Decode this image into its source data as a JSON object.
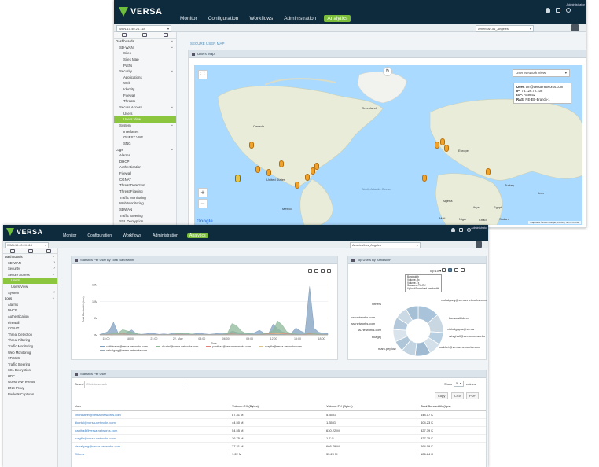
{
  "brand": {
    "name": "VERSA",
    "sub": "NETWORKS",
    "green": "#6fbf3c",
    "dark": "#0e2b3e",
    "accent": "#8cc63f"
  },
  "user_name": "Administrator",
  "nav": [
    "Monitor",
    "Configuration",
    "Workflows",
    "Administration",
    "Analytics"
  ],
  "nav_active": "Analytics",
  "w1": {
    "appliance": "WAN-10.40.24.118",
    "timezone": "America/Los_Angeles",
    "breadcrumb": "SECURE USER MAP",
    "panel_title": "Users Map",
    "map_view": "User Network View",
    "popup": {
      "user_label": "User:",
      "user": "tim@versa-networks.com",
      "ip_label": "IP:",
      "ip": "76.126.72.108",
      "isp_label": "ISP:",
      "isp": "AS9852",
      "ras_label": "RAS:",
      "ras": "NE-EE-Branch-1"
    },
    "map_labels": [
      "Greenland",
      "Canada",
      "United States",
      "Mexico",
      "North Atlantic Ocean",
      "Europe",
      "Algeria",
      "Libya",
      "Egypt",
      "Mali",
      "Niger",
      "Chad",
      "Sudan",
      "Turkey",
      "Iran"
    ],
    "attribution": "Map data ©2020 Google, INEGI | Terms of Use",
    "google": "Google",
    "sidebar": [
      {
        "label": "Dashboards",
        "level": 0,
        "chev": "⌄"
      },
      {
        "label": "SD-WAN",
        "level": 1,
        "chev": "⌄"
      },
      {
        "label": "Sites",
        "level": 2
      },
      {
        "label": "Sites Map",
        "level": 2
      },
      {
        "label": "Paths",
        "level": 2
      },
      {
        "label": "Security",
        "level": 1,
        "chev": "⌄"
      },
      {
        "label": "Applications",
        "level": 2
      },
      {
        "label": "Web",
        "level": 2
      },
      {
        "label": "Identity",
        "level": 2
      },
      {
        "label": "Firewall",
        "level": 2
      },
      {
        "label": "Threats",
        "level": 2
      },
      {
        "label": "Secure Access",
        "level": 1,
        "chev": "⌄"
      },
      {
        "label": "Users",
        "level": 2
      },
      {
        "label": "Users View",
        "level": 2,
        "active": true
      },
      {
        "label": "System",
        "level": 1,
        "chev": "⌄"
      },
      {
        "label": "Interfaces",
        "level": 2
      },
      {
        "label": "GUEST VNF",
        "level": 2
      },
      {
        "label": "SNG",
        "level": 2
      },
      {
        "label": "Logs",
        "level": 0,
        "chev": "⌄"
      },
      {
        "label": "Alarms",
        "level": 1
      },
      {
        "label": "DHCP",
        "level": 1
      },
      {
        "label": "Authentication",
        "level": 1
      },
      {
        "label": "Firewall",
        "level": 1
      },
      {
        "label": "CGNAT",
        "level": 1
      },
      {
        "label": "Threat Detection",
        "level": 1
      },
      {
        "label": "Threat Filtering",
        "level": 1
      },
      {
        "label": "Traffic Monitoring",
        "level": 1
      },
      {
        "label": "Web Monitoring",
        "level": 1
      },
      {
        "label": "SDWAN",
        "level": 1
      },
      {
        "label": "Traffic Steering",
        "level": 1
      },
      {
        "label": "SSL Decryption",
        "level": 1
      }
    ]
  },
  "w2": {
    "appliance": "WAN-10.40.24.118",
    "timezone": "America/Los_Angeles",
    "sidebar": [
      {
        "label": "Dashboards",
        "level": 0,
        "chev": "⌄"
      },
      {
        "label": "SD-WAN",
        "level": 1,
        "chev": "›"
      },
      {
        "label": "Security",
        "level": 1,
        "chev": "›"
      },
      {
        "label": "Secure Access",
        "level": 1,
        "chev": "⌄"
      },
      {
        "label": "Users",
        "level": 2,
        "active": true
      },
      {
        "label": "Users View",
        "level": 2
      },
      {
        "label": "System",
        "level": 1,
        "chev": "›"
      },
      {
        "label": "Logs",
        "level": 0,
        "chev": "⌄"
      },
      {
        "label": "Alarms",
        "level": 1
      },
      {
        "label": "DHCP",
        "level": 1
      },
      {
        "label": "Authentication",
        "level": 1
      },
      {
        "label": "Firewall",
        "level": 1
      },
      {
        "label": "CGNAT",
        "level": 1
      },
      {
        "label": "Threat Detection",
        "level": 1
      },
      {
        "label": "Threat Filtering",
        "level": 1
      },
      {
        "label": "Traffic Monitoring",
        "level": 1
      },
      {
        "label": "Web Monitoring",
        "level": 1
      },
      {
        "label": "SDWAN",
        "level": 1
      },
      {
        "label": "Traffic Steering",
        "level": 1
      },
      {
        "label": "SSL Decryption",
        "level": 1
      },
      {
        "label": "HDC",
        "level": 1
      },
      {
        "label": "Guest VNF events",
        "level": 1
      },
      {
        "label": "DNS Proxy",
        "level": 1
      },
      {
        "label": "Packets Captures",
        "level": 1
      }
    ],
    "stats_title": "Statistics Per User By Total Bandwidth",
    "top_title": "Top Users By Bandwidth",
    "top_control": "Top 10",
    "tooltip": [
      "Bandwidth",
      "Volume-Rx",
      "Volume-Tx",
      "Sessions-TX-RX",
      "Upload/Download bandwidth"
    ],
    "stats_table_title": "Statistics Per User",
    "search_label": "Search",
    "search_placeholder": "Click to serach",
    "show_label": "Show",
    "show_value": "5",
    "entries_label": "entries",
    "buttons": [
      "Copy",
      "CSV",
      "PDF"
    ],
    "columns": [
      "User",
      "Volume-RX (Bytes)",
      "Volume-TX (Bytes)",
      "Total Bandwidth (bps)"
    ],
    "rows": [
      [
        "cnithinavel@versa-networks.com",
        "87.31 M",
        "5.35 G",
        "644.17 K"
      ],
      [
        "dkurtal@versa-networks.com",
        "44.50 M",
        "1.35 G",
        "404.23 K"
      ],
      [
        "pantha4@versa-networks.com",
        "54.55 M",
        "630.22 M",
        "327.39 K"
      ],
      [
        "rvagfla@versa-networks.com",
        "26.75 M",
        "1.7 G",
        "327.75 K"
      ],
      [
        "vishalgarg@versa-networks.com",
        "27.21 M",
        "666.79 M",
        "264.09 K"
      ],
      [
        "Others",
        "1.22 M",
        "35.20 M",
        "126.84 K"
      ]
    ],
    "donut_labels": [
      "Others",
      "cs-networks.com",
      "ss-networks.com",
      "ss-networks.com",
      "bkagaj",
      "mark.peplow",
      "parkhet@versa-networks.com",
      "rvisghall@versa-networks",
      "vishalgupta@versa",
      "kumarsikidmo",
      "vishalgarg@versa-networks.com"
    ]
  },
  "chart_data": [
    {
      "type": "area",
      "title": "Statistics Per User By Total Bandwidth",
      "ylabel": "Total Bandwidth (bps)",
      "xlabel": "Time",
      "y_ticks": [
        "0M",
        "5M",
        "10M",
        "15M"
      ],
      "x_ticks": [
        "15:00",
        "18:00",
        "21:00",
        "22. May",
        "03:00",
        "06:00",
        "09:00",
        "12:00",
        "15:00",
        "18:00"
      ],
      "ylim": [
        0,
        16
      ],
      "series": [
        {
          "name": "cnithinavel@versa-networks.com",
          "color": "#7f9fbf",
          "values": [
            0.2,
            0.5,
            1.2,
            3.8,
            0.6,
            0.3,
            0.8,
            1.5,
            0.4,
            0.2,
            0.3,
            0.5,
            0.4,
            0.2,
            0.3,
            0.2,
            0.5,
            0.6,
            0.4,
            0.3,
            0.2,
            0.4,
            0.5,
            0.3,
            0.2,
            0.3,
            0.5,
            0.6,
            0.4,
            1.1,
            0.8,
            0.4,
            0.3,
            0.5,
            0.7,
            1.4,
            0.6,
            0.4,
            3.2,
            1.8,
            0.9,
            0.6,
            0.5,
            2.1,
            1.2,
            0.6,
            14.5,
            2.0,
            0.8,
            0.5,
            0.4
          ]
        },
        {
          "name": "dkurtal@versa-networks.com",
          "color": "#8fb89a",
          "values": [
            0.1,
            0.2,
            0.3,
            0.4,
            0.6,
            1.6,
            1.2,
            0.8,
            0.4,
            0.2,
            0.1,
            0.1,
            0.1,
            0.1,
            0.1,
            0.1,
            0.2,
            0.4,
            0.6,
            0.5,
            0.3,
            0.2,
            0.1,
            0.1,
            0.1,
            0.1,
            0.1,
            0.2,
            0.5,
            3.4,
            2.8,
            1.2,
            0.5,
            0.3,
            0.2,
            0.2,
            0.4,
            0.6,
            1.5,
            4.2,
            3.0,
            1.0,
            0.5,
            0.3,
            0.2,
            0.3,
            0.5,
            0.4,
            0.3,
            0.2,
            0.1
          ]
        },
        {
          "name": "pantha4@versa-networks.com",
          "color": "#e0807a",
          "values": [
            0.1,
            0.1,
            0.2,
            0.2,
            0.2,
            0.3,
            0.2,
            0.1,
            0.1,
            0.1,
            0.1,
            0.1,
            0.1,
            0.1,
            0.1,
            0.1,
            0.1,
            0.2,
            0.2,
            0.1,
            0.1,
            0.1,
            0.1,
            0.1,
            0.1,
            0.1,
            0.1,
            0.1,
            0.2,
            0.3,
            0.2,
            0.2,
            0.1,
            0.1,
            0.1,
            0.1,
            0.2,
            0.3,
            0.4,
            0.6,
            0.5,
            0.3,
            0.2,
            0.1,
            0.1,
            0.2,
            0.3,
            0.2,
            0.1,
            0.1,
            0.1
          ]
        },
        {
          "name": "rvagfla@versa-networks.com",
          "color": "#d9c38a",
          "values": [
            0.1,
            0.1,
            0.1,
            0.2,
            0.2,
            0.2,
            0.1,
            0.1,
            0.1,
            0.1,
            0.1,
            0.1,
            0.1,
            0.1,
            0.1,
            0.1,
            0.1,
            0.1,
            0.1,
            0.1,
            0.1,
            0.1,
            0.1,
            0.1,
            0.1,
            0.1,
            0.1,
            0.1,
            0.1,
            0.2,
            0.2,
            0.1,
            0.1,
            0.1,
            0.1,
            0.1,
            0.1,
            0.2,
            0.3,
            0.4,
            0.3,
            0.2,
            0.1,
            0.1,
            0.1,
            0.1,
            0.2,
            0.2,
            0.1,
            0.1,
            0.1
          ]
        },
        {
          "name": "vishalgarg@versa-networks.com",
          "color": "#9aa7b5",
          "values": [
            0.1,
            0.1,
            0.1,
            0.1,
            0.1,
            0.1,
            0.1,
            0.1,
            0.1,
            0.1,
            0.1,
            0.1,
            0.1,
            0.1,
            0.1,
            0.1,
            0.1,
            0.1,
            0.1,
            0.1,
            0.1,
            0.1,
            0.1,
            0.1,
            0.1,
            0.1,
            0.1,
            0.1,
            0.1,
            0.1,
            0.1,
            0.1,
            0.1,
            0.1,
            0.1,
            0.1,
            0.1,
            0.1,
            0.2,
            0.2,
            0.2,
            0.1,
            0.1,
            0.1,
            0.1,
            0.1,
            0.1,
            0.1,
            0.1,
            0.1,
            0.1
          ]
        }
      ]
    },
    {
      "type": "pie",
      "title": "Top Users By Bandwidth",
      "slices": [
        {
          "label": "vishalgarg@versa-networks.com",
          "value": 14,
          "color": "#a9c4da"
        },
        {
          "label": "kumarsikidmo",
          "value": 12,
          "color": "#c9d7e3"
        },
        {
          "label": "vishalgupta@versa",
          "value": 8,
          "color": "#b7cfe0"
        },
        {
          "label": "rvisghall@versa-networks",
          "value": 8,
          "color": "#d3dfe9"
        },
        {
          "label": "parkhet@versa-networks.com",
          "value": 10,
          "color": "#9fbad1"
        },
        {
          "label": "mark.peplow",
          "value": 9,
          "color": "#c2d3e1"
        },
        {
          "label": "bkagaj",
          "value": 7,
          "color": "#aec6d8"
        },
        {
          "label": "ss-networks.com",
          "value": 8,
          "color": "#d9e3ec"
        },
        {
          "label": "ss-networks.com",
          "value": 8,
          "color": "#b3c9db"
        },
        {
          "label": "cs-networks.com",
          "value": 8,
          "color": "#cbd9e5"
        },
        {
          "label": "Others",
          "value": 8,
          "color": "#a5bfd4"
        }
      ]
    }
  ]
}
